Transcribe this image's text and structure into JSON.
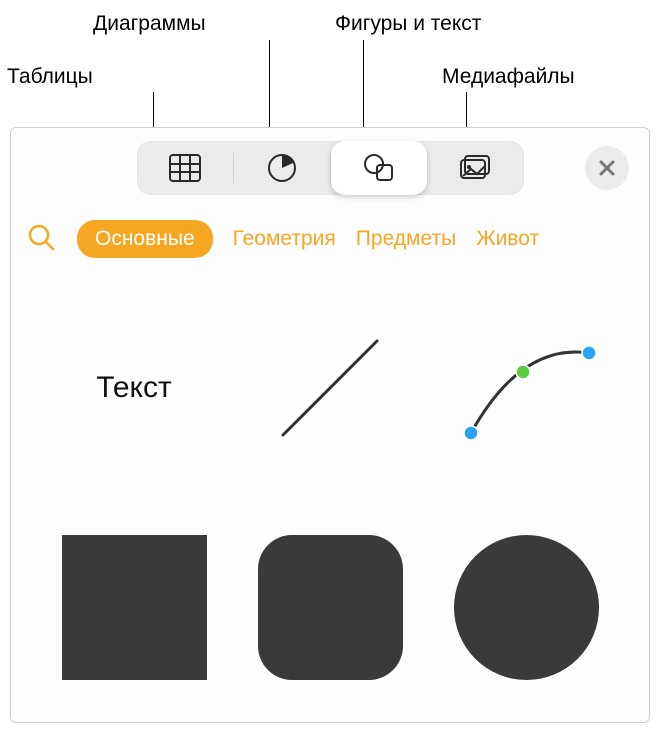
{
  "callouts": {
    "tables": "Таблицы",
    "charts": "Диаграммы",
    "shapes_text": "Фигуры и текст",
    "media": "Медиафайлы"
  },
  "toolbar": {
    "tables_icon": "table-icon",
    "charts_icon": "pie-chart-icon",
    "shapes_icon": "shapes-icon",
    "media_icon": "media-icon",
    "close_icon": "close-icon",
    "selected": "shapes"
  },
  "categories": {
    "selected": "Основные",
    "items": [
      "Геометрия",
      "Предметы",
      "Живот"
    ]
  },
  "shapes": {
    "text_label": "Текст"
  },
  "colors": {
    "accent": "#f5a623",
    "shape_fill": "#3a3a3a"
  }
}
